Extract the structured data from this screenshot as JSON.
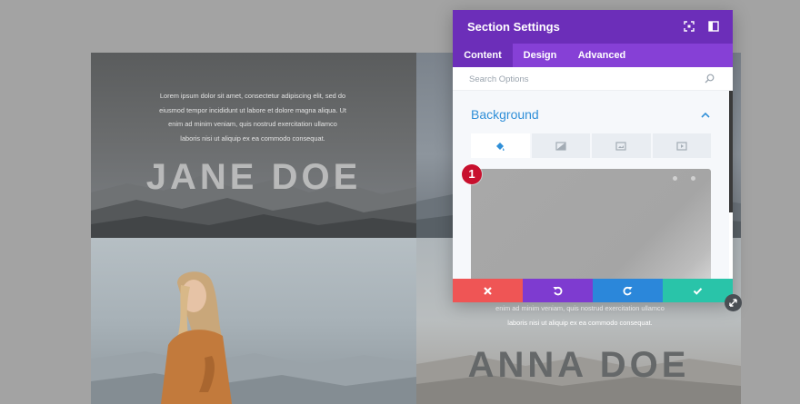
{
  "page": {
    "top_left": {
      "text_lines": [
        "Lorem ipsum dolor sit amet, consectetur adipiscing elit, sed do",
        "eiusmod tempor incididunt ut labore et dolore magna aliqua. Ut",
        "enim ad minim veniam, quis nostrud exercitation ullamco",
        "laboris nisi ut aliquip ex ea commodo consequat."
      ],
      "name": "JANE DOE"
    },
    "bottom_right": {
      "text_lines": [
        "enim ad minim veniam, quis nostrud exercitation ullamco",
        "laboris nisi ut aliquip ex ea commodo consequat."
      ],
      "name": "ANNA DOE"
    }
  },
  "modal": {
    "title": "Section Settings",
    "header_icons": [
      "fullscreen-icon",
      "sidebar-toggle-icon"
    ],
    "tabs": [
      {
        "label": "Content",
        "active": true
      },
      {
        "label": "Design",
        "active": false
      },
      {
        "label": "Advanced",
        "active": false
      }
    ],
    "search": {
      "placeholder": "Search Options"
    },
    "section": {
      "title": "Background",
      "background_tabs": [
        "color-fill-icon",
        "gradient-icon",
        "image-icon",
        "video-icon"
      ],
      "active_background_tab": 0
    },
    "actions": [
      "close-icon",
      "undo-icon",
      "redo-icon",
      "check-icon"
    ],
    "colors": {
      "header": "#6c2eb9",
      "tabs": "#8640d6",
      "section_title": "#2f8fd8",
      "cancel": "#ef5555",
      "undo": "#7e3bd0",
      "redo": "#2b87da",
      "save": "#29c4a9"
    }
  },
  "annotation": {
    "step": "1",
    "color": "#c8102e"
  }
}
